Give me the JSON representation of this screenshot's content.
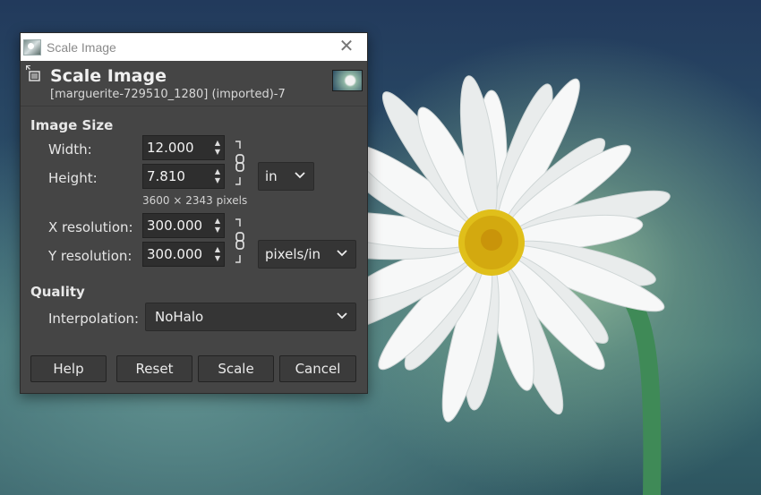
{
  "window": {
    "title": "Scale Image"
  },
  "header": {
    "title": "Scale Image",
    "subtitle": "[marguerite-729510_1280] (imported)-7"
  },
  "image_size": {
    "section_label": "Image Size",
    "width_label": "Width:",
    "width_value": "12.000",
    "height_label": "Height:",
    "height_value": "7.810",
    "unit": "in",
    "pixel_dims": "3600 × 2343 pixels",
    "xres_label": "X resolution:",
    "xres_value": "300.000",
    "yres_label": "Y resolution:",
    "yres_value": "300.000",
    "res_unit": "pixels/in"
  },
  "quality": {
    "section_label": "Quality",
    "interp_label": "Interpolation:",
    "interp_value": "NoHalo"
  },
  "buttons": {
    "help": "Help",
    "reset": "Reset",
    "scale": "Scale",
    "cancel": "Cancel"
  },
  "icons": {
    "app": "gimp-image-icon",
    "close": "close-icon",
    "chain": "chain-link-icon",
    "dropdown": "chevron-down-icon"
  },
  "colors": {
    "dialog_bg": "#454545",
    "titlebar_bg": "#ffffff",
    "input_bg": "#2e2e2e"
  }
}
